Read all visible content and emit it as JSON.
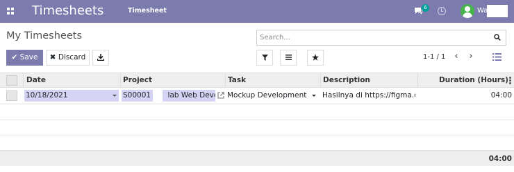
{
  "navbar": {
    "app_name": "Timesheets",
    "menu_item": "Timesheet",
    "chat_badge": "6",
    "user_name": "Wa",
    "accent_color": "#7c7bad"
  },
  "control_panel": {
    "title": "My Timesheets",
    "search": {
      "placeholder": "Search...",
      "value": ""
    },
    "buttons": {
      "save": "Save",
      "discard": "Discard"
    },
    "pager": "1-1 / 1"
  },
  "table": {
    "columns": [
      "Date",
      "Project",
      "Task",
      "Description",
      "Duration (Hours)"
    ],
    "rows": [
      {
        "date": "10/18/2021",
        "project": "S00001 - ",
        "project_suffix": "lab Web Develo",
        "task": "Mockup Development",
        "description": "Hasilnya di https://figma.com",
        "duration": "04:00"
      }
    ],
    "total": "04:00"
  }
}
